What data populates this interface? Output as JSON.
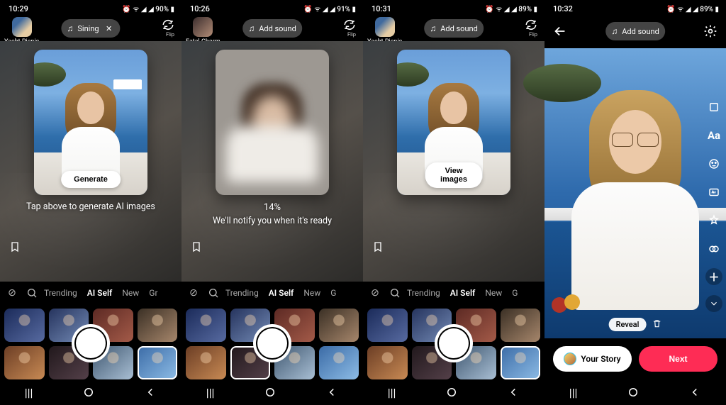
{
  "panes": [
    {
      "status": {
        "time": "10:29",
        "icons": "⏰ ᯤ ◢ ◢ 90% ▮"
      },
      "avatar_label": "Yacht Picnic",
      "sound": {
        "label": "Sining",
        "has_close": true
      },
      "flip": "Flip",
      "action_btn": "Generate",
      "caption": "Tap above to generate AI images",
      "tabs": {
        "items": [
          "Trending",
          "AI Self",
          "New",
          "Gr"
        ],
        "active": 1
      },
      "selected_thumb": 7
    },
    {
      "status": {
        "time": "10:26",
        "icons": "⏰ ᯤ ◢ ◢ 91% ▮"
      },
      "avatar_label": "Fatal Charm",
      "sound": {
        "label": "Add sound",
        "has_close": false
      },
      "flip": "Flip",
      "percent": "14%",
      "caption": "We'll notify you when it's ready",
      "tabs": {
        "items": [
          "Trending",
          "AI Self",
          "New",
          "G"
        ],
        "active": 1
      },
      "selected_thumb": 5
    },
    {
      "status": {
        "time": "10:31",
        "icons": "⏰ ᯤ ◢ ◢ 89% ▮"
      },
      "avatar_label": "Yacht Picnic",
      "sound": {
        "label": "Add sound",
        "has_close": false
      },
      "flip": "Flip",
      "action_btn": "View images",
      "caption": "",
      "tabs": {
        "items": [
          "Trending",
          "AI Self",
          "New",
          "G"
        ],
        "active": 1
      },
      "selected_thumb": 7
    },
    {
      "status": {
        "time": "10:32",
        "icons": "⏰ ᯤ ◢ ◢ 89% ▮"
      },
      "sound": {
        "label": "Add sound",
        "has_close": false
      },
      "reveal": "Reveal",
      "story": "Your Story",
      "next": "Next"
    }
  ]
}
